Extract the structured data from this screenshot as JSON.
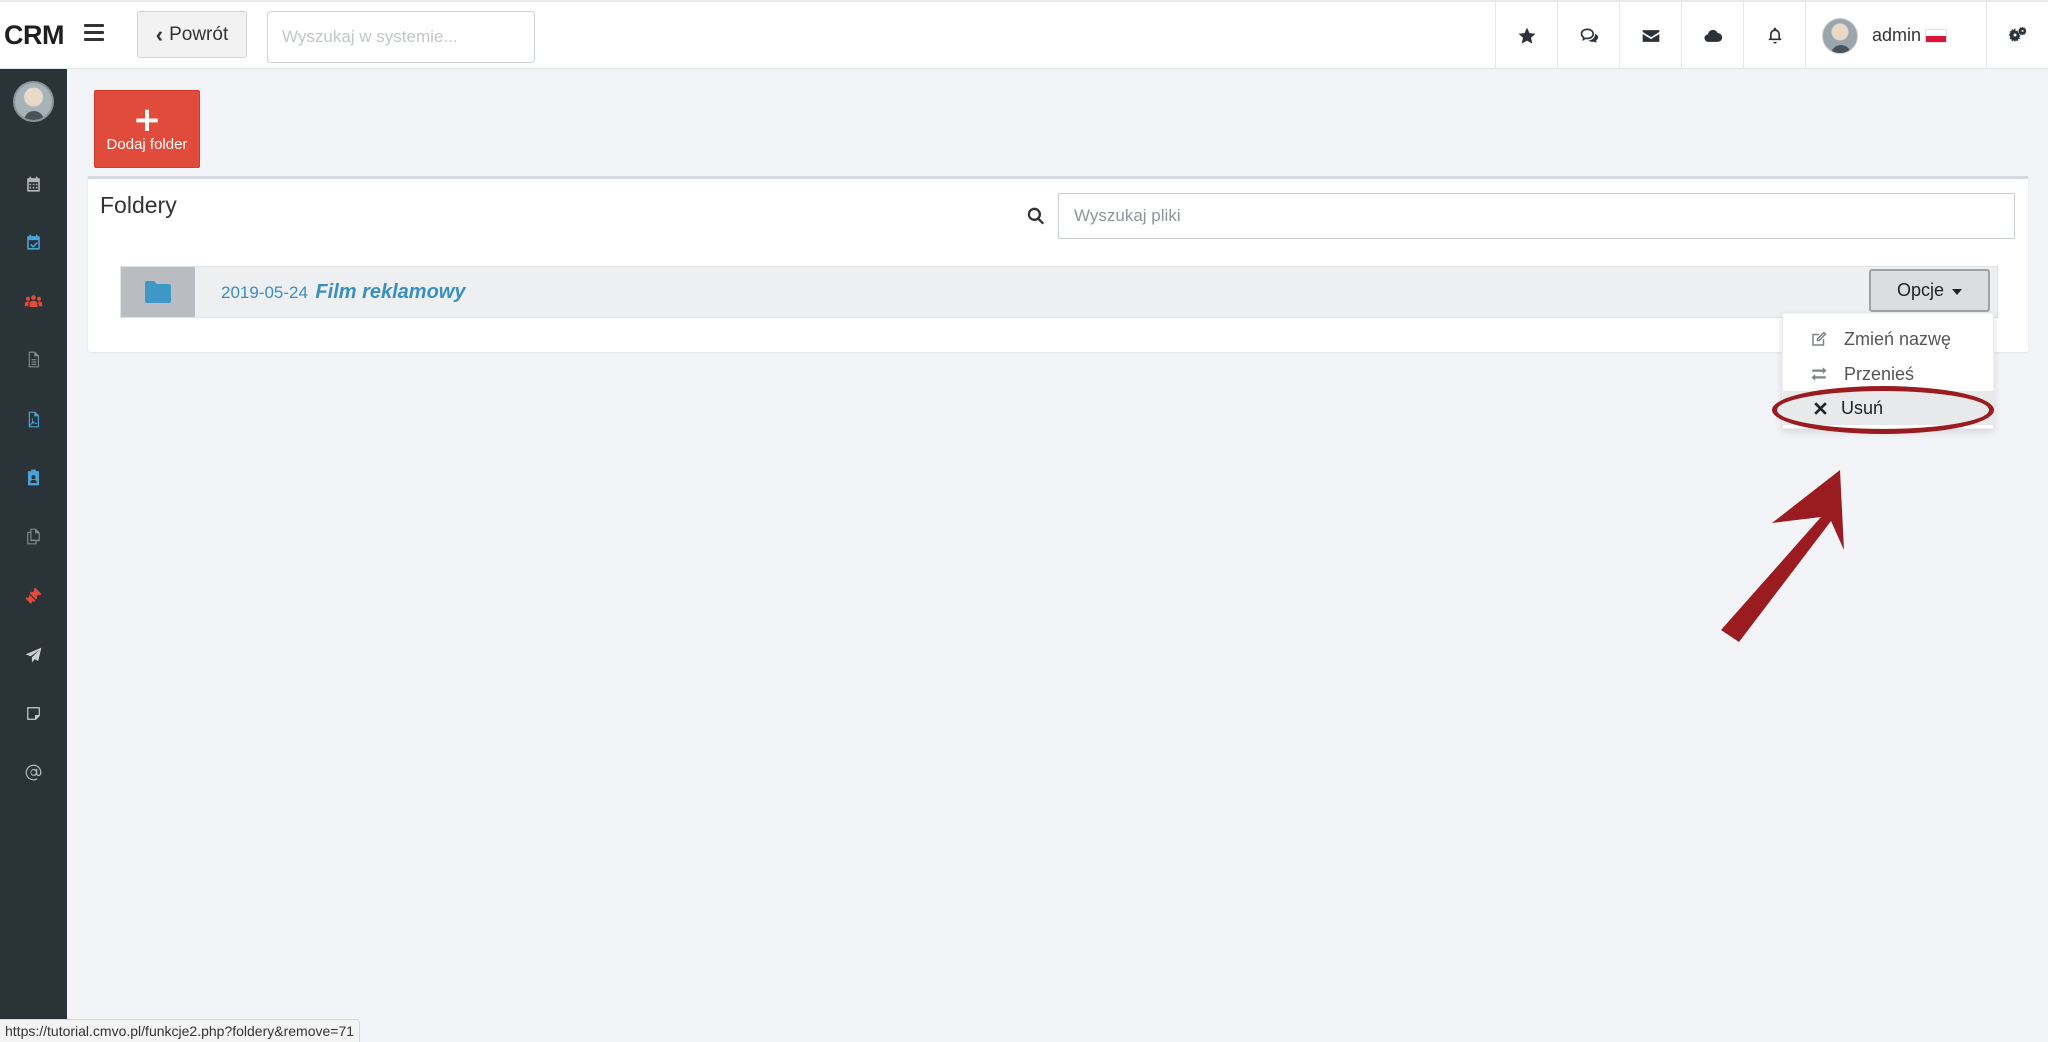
{
  "app": {
    "brand": "CRM"
  },
  "header": {
    "back_label": "Powrót",
    "search_placeholder": "Wyszukaj w systemie...",
    "icons": [
      "star-icon",
      "comments-icon",
      "envelope-icon",
      "cloud-icon",
      "bell-icon"
    ],
    "user": {
      "name": "admin"
    },
    "settings_icon": "cogs-icon"
  },
  "sidebar": {
    "items": [
      {
        "icon": "calendar-icon",
        "color": "#aeb6bb"
      },
      {
        "icon": "calendar-check-icon",
        "color": "#4aa3d8"
      },
      {
        "icon": "users-icon",
        "color": "#e24a3b"
      },
      {
        "icon": "document-icon",
        "color": "#7f888e"
      },
      {
        "icon": "pdf-icon",
        "color": "#4aa3d8"
      },
      {
        "icon": "clipboard-user-icon",
        "color": "#4aa3d8"
      },
      {
        "icon": "copy-icon",
        "color": "#7f888e"
      },
      {
        "icon": "ticket-icon",
        "color": "#e24a3b"
      },
      {
        "icon": "paper-plane-icon",
        "color": "#c9d0d4"
      },
      {
        "icon": "sticky-note-icon",
        "color": "#c9d0d4"
      },
      {
        "icon": "at-icon",
        "color": "#aeb6bb"
      }
    ]
  },
  "toolbar": {
    "add_folder_label": "Dodaj folder"
  },
  "panel": {
    "title": "Foldery",
    "search_placeholder": "Wyszukaj pliki",
    "folders": [
      {
        "date": "2019-05-24",
        "name": "Film reklamowy"
      }
    ],
    "options_label": "Opcje"
  },
  "dropdown": {
    "items": [
      {
        "label": "Zmień nazwę",
        "icon": "edit-icon"
      },
      {
        "label": "Przenieś",
        "icon": "exchange-icon"
      },
      {
        "label": "Usuń",
        "icon": "times-icon"
      }
    ],
    "highlighted": "Usuń"
  },
  "colors": {
    "accent_red": "#e14b3b",
    "link_blue": "#3a8fbe",
    "annotation": "#9b1c20"
  },
  "status_url": "https://tutorial.cmvo.pl/funkcje2.php?foldery&remove=71"
}
